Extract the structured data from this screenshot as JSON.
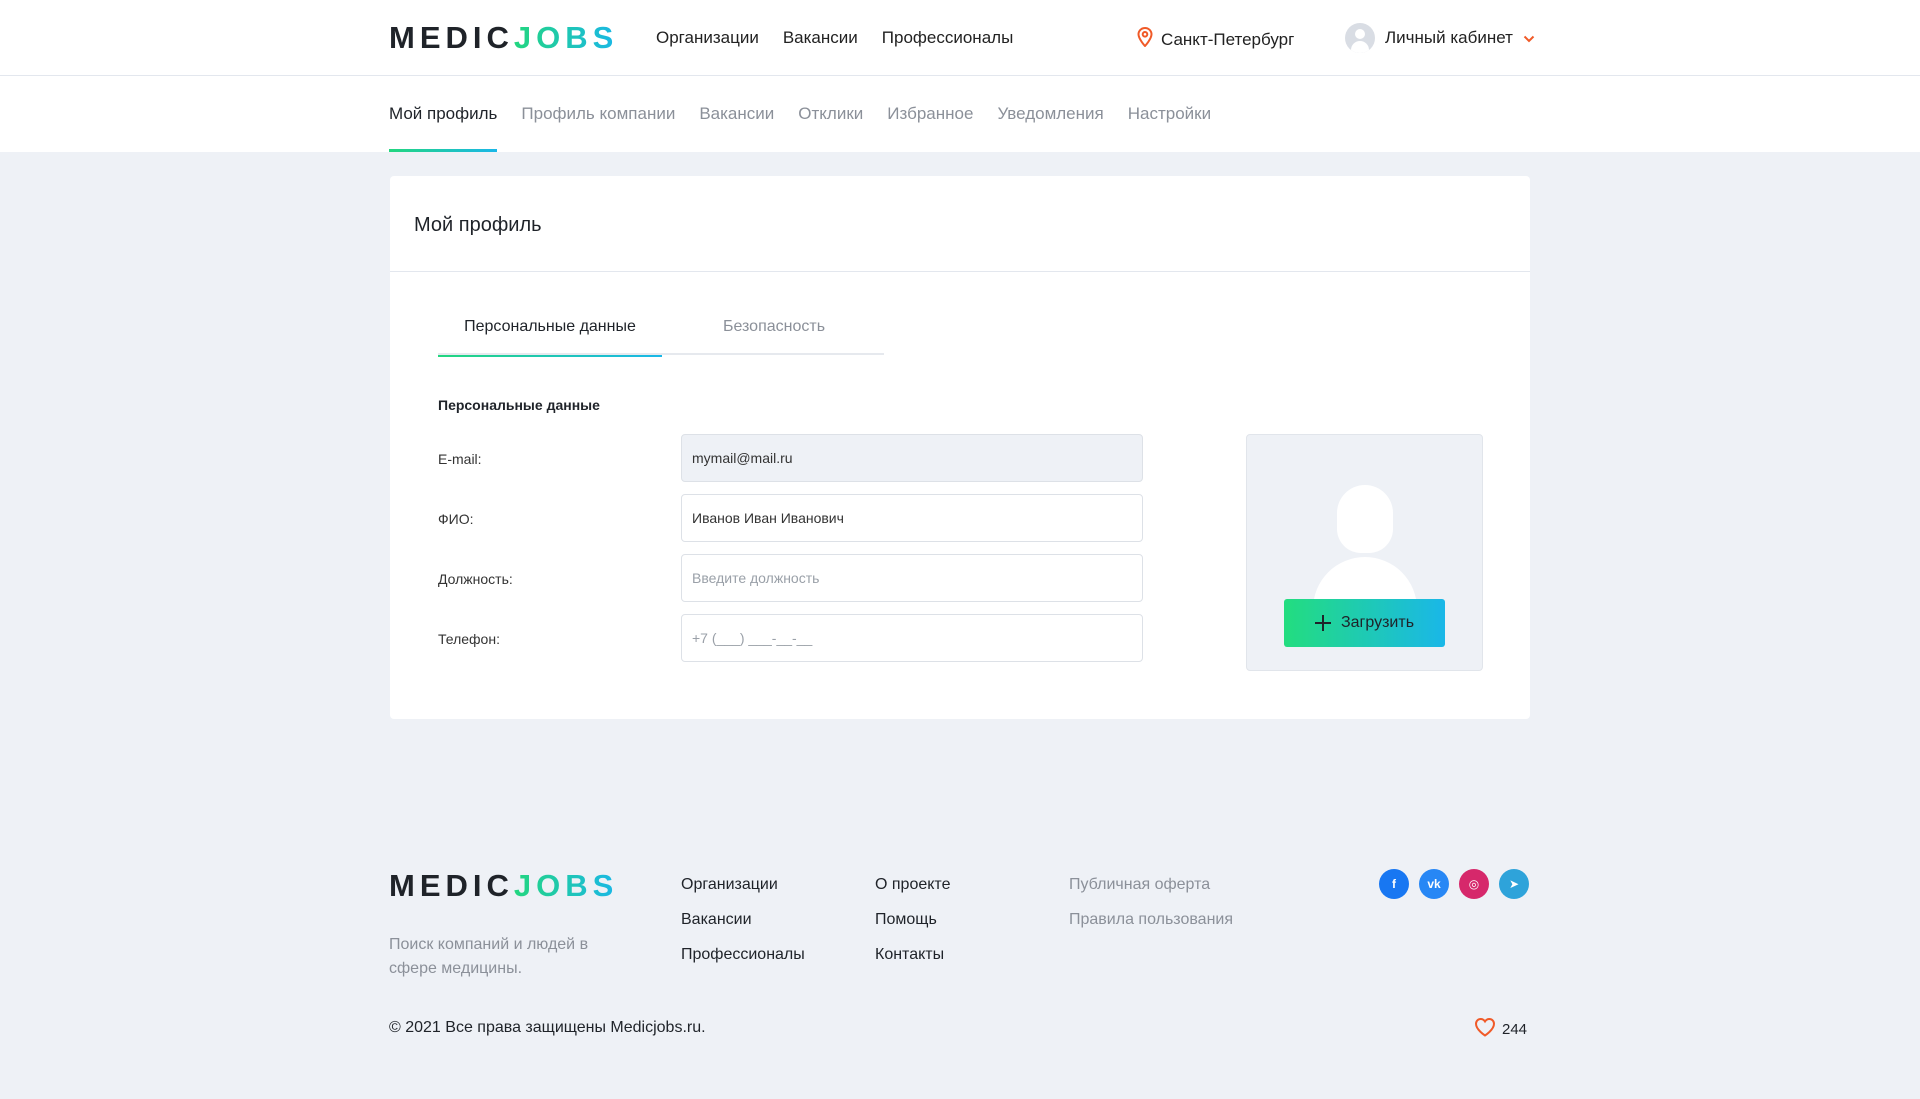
{
  "logo": {
    "part1": "MEDIC",
    "part2": "JOBS"
  },
  "header": {
    "nav": [
      "Организации",
      "Вакансии",
      "Профессионалы"
    ],
    "city": "Санкт-Петербург",
    "account_label": "Личный кабинет"
  },
  "subnav": {
    "items": [
      "Мой профиль",
      "Профиль компании",
      "Вакансии",
      "Отклики",
      "Избранное",
      "Уведомления",
      "Настройки"
    ],
    "active_index": 0
  },
  "profile": {
    "title": "Мой профиль",
    "tabs": [
      "Персональные данные",
      "Безопасность"
    ],
    "section_label": "Персональные данные",
    "fields": [
      {
        "label": "E-mail:",
        "value": "mymail@mail.ru",
        "placeholder": ""
      },
      {
        "label": "ФИО:",
        "value": "Иванов Иван Иванович",
        "placeholder": ""
      },
      {
        "label": "Должность:",
        "value": "",
        "placeholder": "Введите должность"
      },
      {
        "label": "Телефон:",
        "value": "",
        "placeholder": "+7 (___) ___-__-__"
      }
    ],
    "upload_label": "Загрузить"
  },
  "footer": {
    "tagline": "Поиск компаний и людей в сфере медицины.",
    "col1": [
      "Организации",
      "Вакансии",
      "Профессионалы"
    ],
    "col2": [
      "О проекте",
      "Помощь",
      "Контакты"
    ],
    "col3": [
      "Публичная оферта",
      "Правила пользования"
    ],
    "socials": [
      {
        "name": "facebook-icon",
        "glyph": "f",
        "color": "#1877f2"
      },
      {
        "name": "vk-icon",
        "glyph": "vk",
        "color": "#2787f5"
      },
      {
        "name": "instagram-icon",
        "glyph": "◎",
        "color": "#d6286b"
      },
      {
        "name": "telegram-icon",
        "glyph": "➤",
        "color": "#2ea3da"
      }
    ],
    "copyright": "© 2021 Все права защищены Medicjobs.ru.",
    "likes": "244"
  },
  "colors": {
    "accent_start": "#23d67f",
    "accent_end": "#1ab7e8",
    "pin": "#f05a28",
    "heart": "#f05a28"
  }
}
